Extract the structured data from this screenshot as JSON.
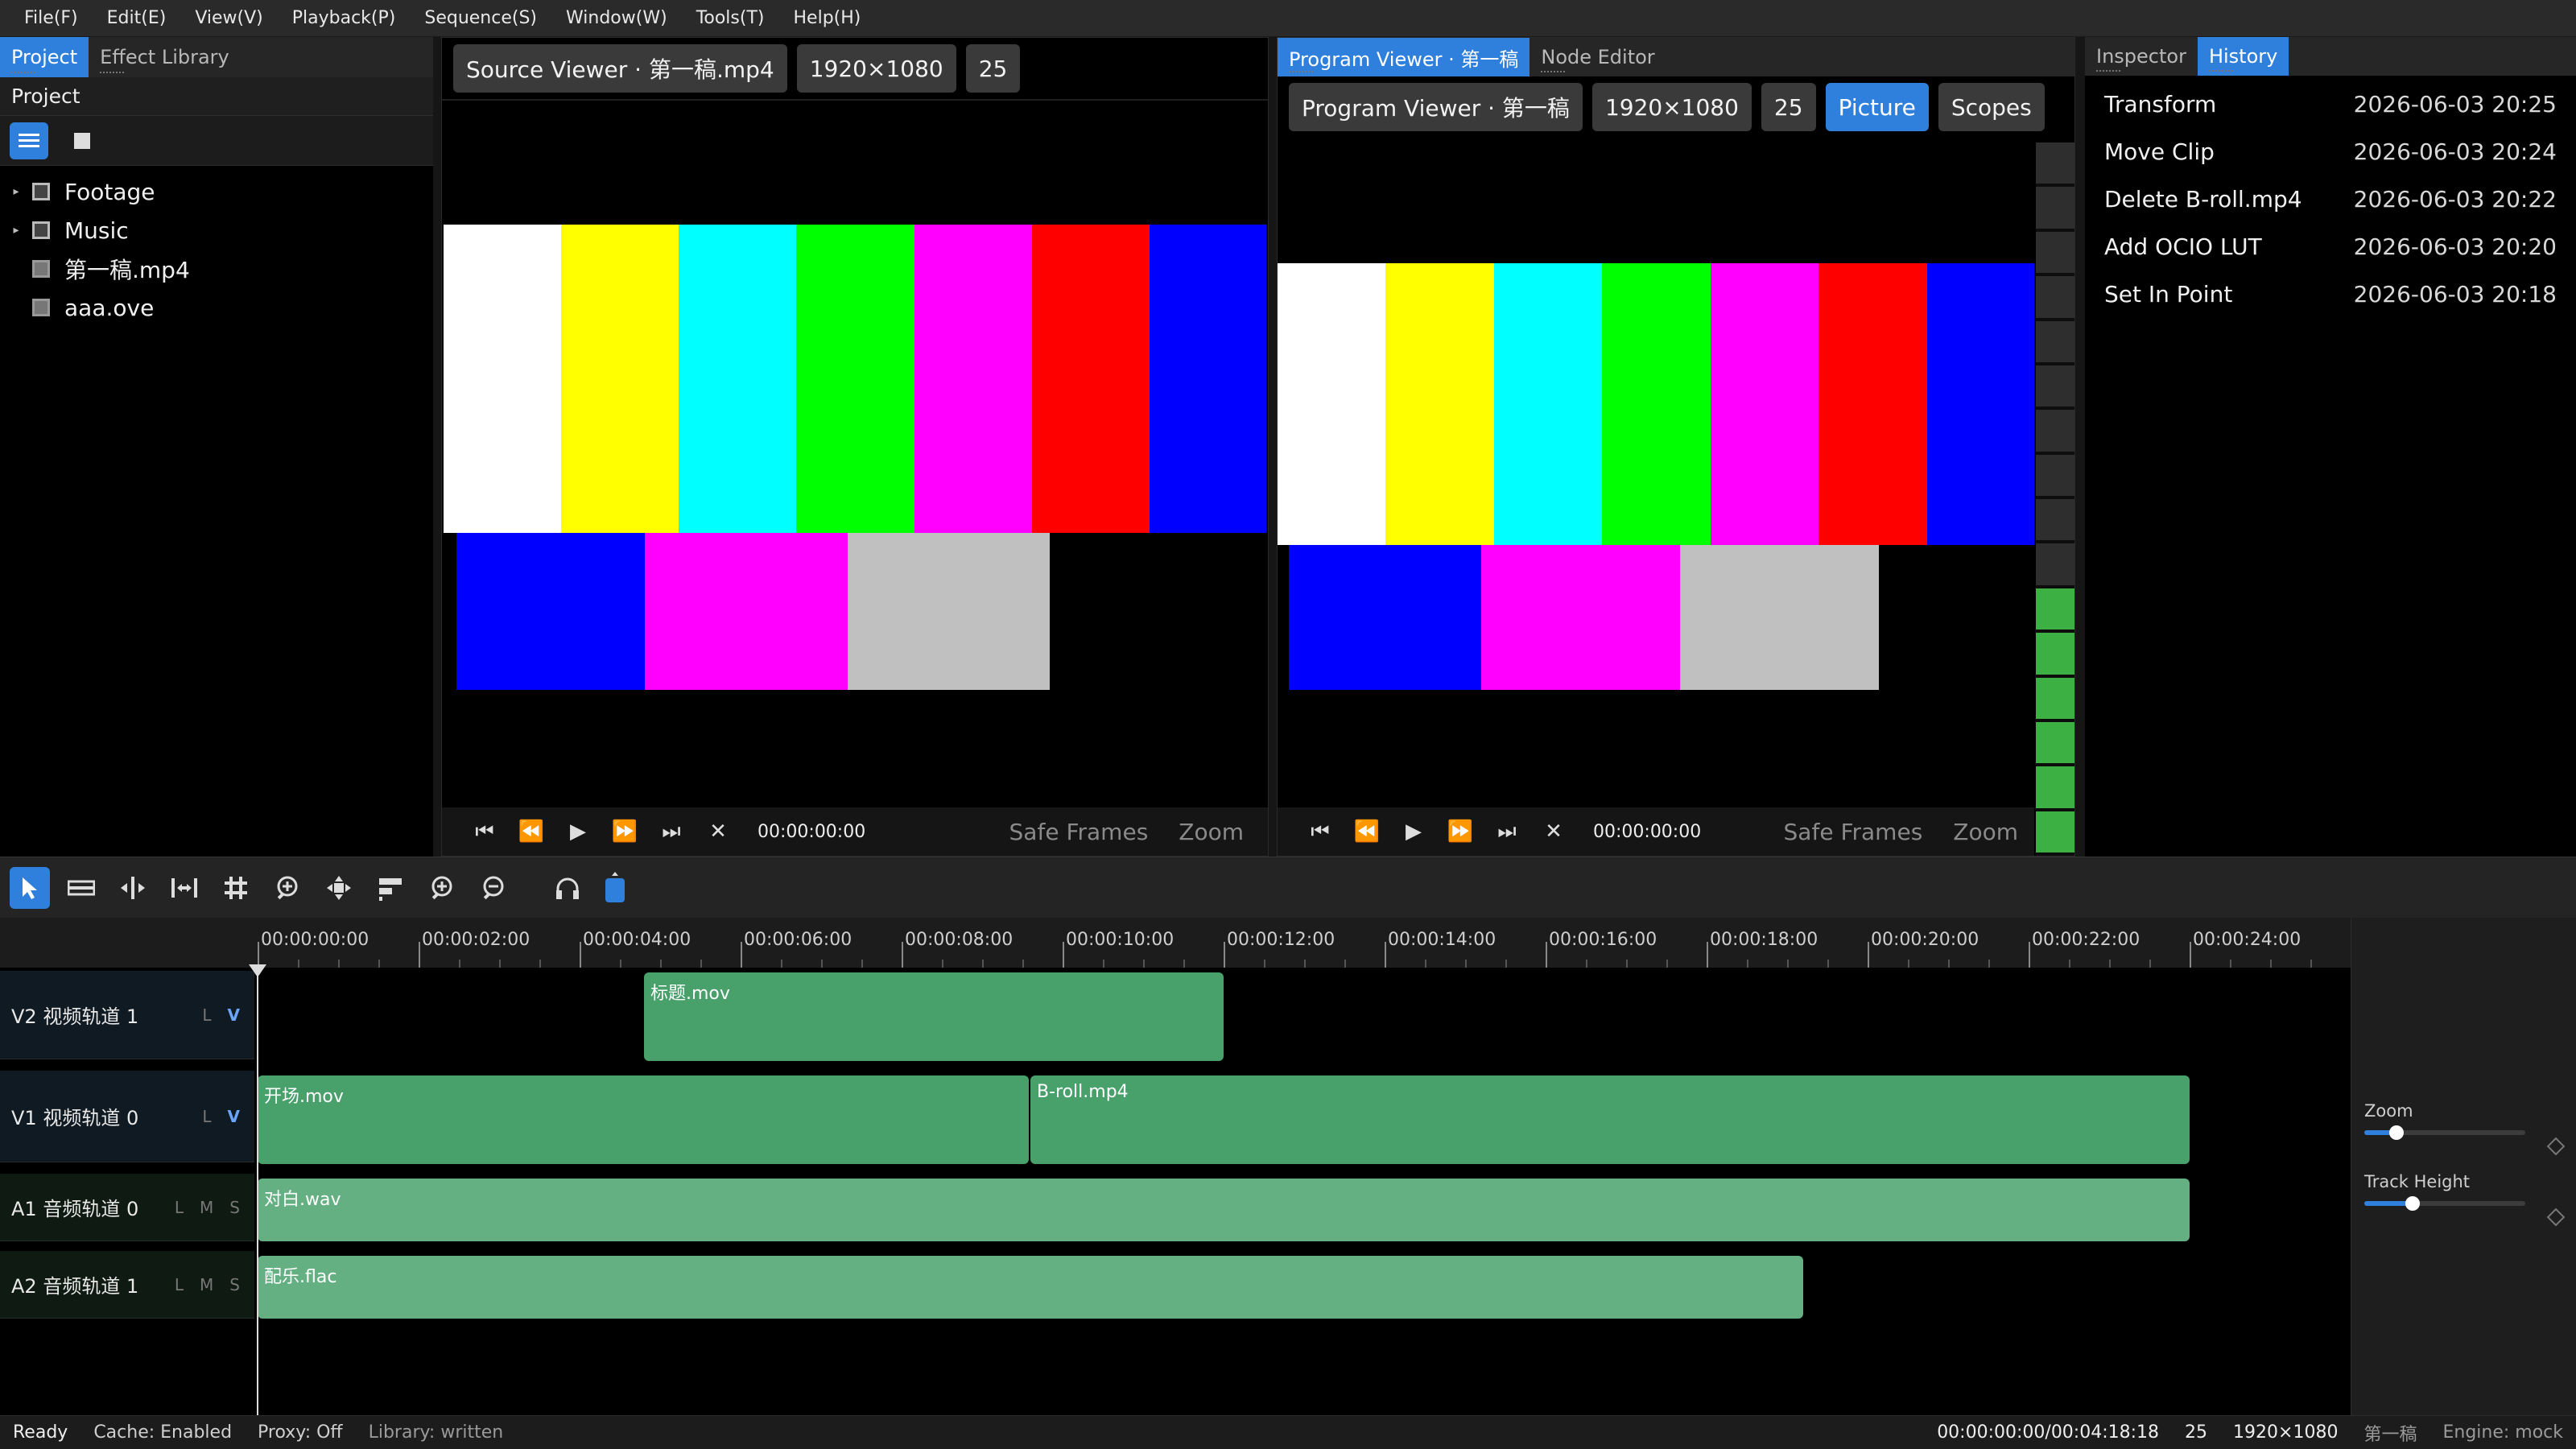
{
  "menubar": [
    "File(F)",
    "Edit(E)",
    "View(V)",
    "Playback(P)",
    "Sequence(S)",
    "Window(W)",
    "Tools(T)",
    "Help(H)"
  ],
  "left_panel": {
    "tabs": [
      "Project",
      "Effect Library"
    ],
    "header": "Project",
    "tree": [
      {
        "label": "Footage",
        "folder": true
      },
      {
        "label": "Music",
        "folder": true
      },
      {
        "label": "第一稿.mp4",
        "folder": false
      },
      {
        "label": "aaa.ove",
        "folder": false
      }
    ]
  },
  "source_viewer": {
    "title": "Source Viewer · 第一稿.mp4",
    "resolution": "1920×1080",
    "fps": "25",
    "timecode": "00:00:00:00",
    "safe_frames": "Safe Frames",
    "zoom": "Zoom"
  },
  "program_viewer": {
    "tabs": [
      "Program Viewer · 第一稿",
      "Node Editor"
    ],
    "title": "Program Viewer · 第一稿",
    "resolution": "1920×1080",
    "fps": "25",
    "picture": "Picture",
    "scopes": "Scopes",
    "timecode": "00:00:00:00",
    "safe_frames": "Safe Frames",
    "zoom": "Zoom"
  },
  "right_panel": {
    "tabs": [
      "Inspector",
      "History"
    ],
    "history": [
      {
        "action": "Transform",
        "time": "2026-06-03 20:25"
      },
      {
        "action": "Move Clip",
        "time": "2026-06-03 20:24"
      },
      {
        "action": "Delete B-roll.mp4",
        "time": "2026-06-03 20:22"
      },
      {
        "action": "Add OCIO LUT",
        "time": "2026-06-03 20:20"
      },
      {
        "action": "Set In Point",
        "time": "2026-06-03 20:18"
      }
    ]
  },
  "colors": {
    "accent": "#2f7fdc",
    "clip_video": "#48a06a",
    "clip_audio": "#64b082"
  },
  "color_bars": {
    "top": [
      "#ffffff",
      "#ffff00",
      "#00ffff",
      "#00ff00",
      "#ff00ff",
      "#ff0000",
      "#0000ff"
    ],
    "bottom": [
      "#0000ff",
      "#ff00ff",
      "#c0c0c0",
      "#000000"
    ]
  },
  "ruler": [
    "00:00:00:00",
    "00:00:02:00",
    "00:00:04:00",
    "00:00:06:00",
    "00:00:08:00",
    "00:00:10:00",
    "00:00:12:00",
    "00:00:14:00",
    "00:00:16:00",
    "00:00:18:00",
    "00:00:20:00",
    "00:00:22:00",
    "00:00:24:00"
  ],
  "tracks": [
    {
      "name": "V2 视频轨道 1",
      "flags": [
        "L",
        "V"
      ]
    },
    {
      "name": "V1 视频轨道 0",
      "flags": [
        "L",
        "V"
      ]
    },
    {
      "name": "A1 音频轨道 0",
      "flags": [
        "L",
        "M",
        "S"
      ]
    },
    {
      "name": "A2 音频轨道 1",
      "flags": [
        "L",
        "M",
        "S"
      ]
    }
  ],
  "clips": {
    "title_mov": "标题.mov",
    "opening_mov": "开场.mov",
    "broll_mp4": "B-roll.mp4",
    "dialogue_wav": "对白.wav",
    "music_flac": "配乐.flac"
  },
  "timeline_side": {
    "zoom_label": "Zoom",
    "zoom_level": 0.2,
    "track_height_label": "Track Height",
    "track_height_level": 0.3
  },
  "meter_level": 0.35,
  "status": {
    "ready": "Ready",
    "cache": "Cache: Enabled",
    "proxy": "Proxy: Off",
    "library": "Library: written",
    "timecode": "00:00:00:00/00:04:18:18",
    "fps": "25",
    "resolution": "1920×1080",
    "sequence": "第一稿",
    "engine": "Engine: mock"
  }
}
